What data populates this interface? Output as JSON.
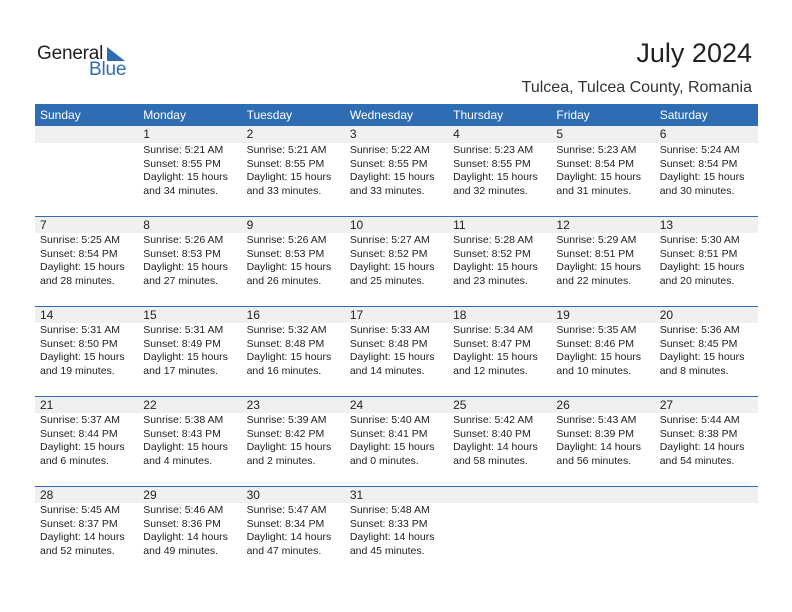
{
  "logo": {
    "word1": "General",
    "word2": "Blue"
  },
  "header": {
    "title": "July 2024",
    "location": "Tulcea, Tulcea County, Romania"
  },
  "colors": {
    "accent": "#2E6DB4",
    "band": "#F0F0F0"
  },
  "weekdays": [
    "Sunday",
    "Monday",
    "Tuesday",
    "Wednesday",
    "Thursday",
    "Friday",
    "Saturday"
  ],
  "weeks": [
    [
      null,
      {
        "day": "1",
        "sunrise": "Sunrise: 5:21 AM",
        "sunset": "Sunset: 8:55 PM",
        "daylight1": "Daylight: 15 hours",
        "daylight2": "and 34 minutes."
      },
      {
        "day": "2",
        "sunrise": "Sunrise: 5:21 AM",
        "sunset": "Sunset: 8:55 PM",
        "daylight1": "Daylight: 15 hours",
        "daylight2": "and 33 minutes."
      },
      {
        "day": "3",
        "sunrise": "Sunrise: 5:22 AM",
        "sunset": "Sunset: 8:55 PM",
        "daylight1": "Daylight: 15 hours",
        "daylight2": "and 33 minutes."
      },
      {
        "day": "4",
        "sunrise": "Sunrise: 5:23 AM",
        "sunset": "Sunset: 8:55 PM",
        "daylight1": "Daylight: 15 hours",
        "daylight2": "and 32 minutes."
      },
      {
        "day": "5",
        "sunrise": "Sunrise: 5:23 AM",
        "sunset": "Sunset: 8:54 PM",
        "daylight1": "Daylight: 15 hours",
        "daylight2": "and 31 minutes."
      },
      {
        "day": "6",
        "sunrise": "Sunrise: 5:24 AM",
        "sunset": "Sunset: 8:54 PM",
        "daylight1": "Daylight: 15 hours",
        "daylight2": "and 30 minutes."
      }
    ],
    [
      {
        "day": "7",
        "sunrise": "Sunrise: 5:25 AM",
        "sunset": "Sunset: 8:54 PM",
        "daylight1": "Daylight: 15 hours",
        "daylight2": "and 28 minutes."
      },
      {
        "day": "8",
        "sunrise": "Sunrise: 5:26 AM",
        "sunset": "Sunset: 8:53 PM",
        "daylight1": "Daylight: 15 hours",
        "daylight2": "and 27 minutes."
      },
      {
        "day": "9",
        "sunrise": "Sunrise: 5:26 AM",
        "sunset": "Sunset: 8:53 PM",
        "daylight1": "Daylight: 15 hours",
        "daylight2": "and 26 minutes."
      },
      {
        "day": "10",
        "sunrise": "Sunrise: 5:27 AM",
        "sunset": "Sunset: 8:52 PM",
        "daylight1": "Daylight: 15 hours",
        "daylight2": "and 25 minutes."
      },
      {
        "day": "11",
        "sunrise": "Sunrise: 5:28 AM",
        "sunset": "Sunset: 8:52 PM",
        "daylight1": "Daylight: 15 hours",
        "daylight2": "and 23 minutes."
      },
      {
        "day": "12",
        "sunrise": "Sunrise: 5:29 AM",
        "sunset": "Sunset: 8:51 PM",
        "daylight1": "Daylight: 15 hours",
        "daylight2": "and 22 minutes."
      },
      {
        "day": "13",
        "sunrise": "Sunrise: 5:30 AM",
        "sunset": "Sunset: 8:51 PM",
        "daylight1": "Daylight: 15 hours",
        "daylight2": "and 20 minutes."
      }
    ],
    [
      {
        "day": "14",
        "sunrise": "Sunrise: 5:31 AM",
        "sunset": "Sunset: 8:50 PM",
        "daylight1": "Daylight: 15 hours",
        "daylight2": "and 19 minutes."
      },
      {
        "day": "15",
        "sunrise": "Sunrise: 5:31 AM",
        "sunset": "Sunset: 8:49 PM",
        "daylight1": "Daylight: 15 hours",
        "daylight2": "and 17 minutes."
      },
      {
        "day": "16",
        "sunrise": "Sunrise: 5:32 AM",
        "sunset": "Sunset: 8:48 PM",
        "daylight1": "Daylight: 15 hours",
        "daylight2": "and 16 minutes."
      },
      {
        "day": "17",
        "sunrise": "Sunrise: 5:33 AM",
        "sunset": "Sunset: 8:48 PM",
        "daylight1": "Daylight: 15 hours",
        "daylight2": "and 14 minutes."
      },
      {
        "day": "18",
        "sunrise": "Sunrise: 5:34 AM",
        "sunset": "Sunset: 8:47 PM",
        "daylight1": "Daylight: 15 hours",
        "daylight2": "and 12 minutes."
      },
      {
        "day": "19",
        "sunrise": "Sunrise: 5:35 AM",
        "sunset": "Sunset: 8:46 PM",
        "daylight1": "Daylight: 15 hours",
        "daylight2": "and 10 minutes."
      },
      {
        "day": "20",
        "sunrise": "Sunrise: 5:36 AM",
        "sunset": "Sunset: 8:45 PM",
        "daylight1": "Daylight: 15 hours",
        "daylight2": "and 8 minutes."
      }
    ],
    [
      {
        "day": "21",
        "sunrise": "Sunrise: 5:37 AM",
        "sunset": "Sunset: 8:44 PM",
        "daylight1": "Daylight: 15 hours",
        "daylight2": "and 6 minutes."
      },
      {
        "day": "22",
        "sunrise": "Sunrise: 5:38 AM",
        "sunset": "Sunset: 8:43 PM",
        "daylight1": "Daylight: 15 hours",
        "daylight2": "and 4 minutes."
      },
      {
        "day": "23",
        "sunrise": "Sunrise: 5:39 AM",
        "sunset": "Sunset: 8:42 PM",
        "daylight1": "Daylight: 15 hours",
        "daylight2": "and 2 minutes."
      },
      {
        "day": "24",
        "sunrise": "Sunrise: 5:40 AM",
        "sunset": "Sunset: 8:41 PM",
        "daylight1": "Daylight: 15 hours",
        "daylight2": "and 0 minutes."
      },
      {
        "day": "25",
        "sunrise": "Sunrise: 5:42 AM",
        "sunset": "Sunset: 8:40 PM",
        "daylight1": "Daylight: 14 hours",
        "daylight2": "and 58 minutes."
      },
      {
        "day": "26",
        "sunrise": "Sunrise: 5:43 AM",
        "sunset": "Sunset: 8:39 PM",
        "daylight1": "Daylight: 14 hours",
        "daylight2": "and 56 minutes."
      },
      {
        "day": "27",
        "sunrise": "Sunrise: 5:44 AM",
        "sunset": "Sunset: 8:38 PM",
        "daylight1": "Daylight: 14 hours",
        "daylight2": "and 54 minutes."
      }
    ],
    [
      {
        "day": "28",
        "sunrise": "Sunrise: 5:45 AM",
        "sunset": "Sunset: 8:37 PM",
        "daylight1": "Daylight: 14 hours",
        "daylight2": "and 52 minutes."
      },
      {
        "day": "29",
        "sunrise": "Sunrise: 5:46 AM",
        "sunset": "Sunset: 8:36 PM",
        "daylight1": "Daylight: 14 hours",
        "daylight2": "and 49 minutes."
      },
      {
        "day": "30",
        "sunrise": "Sunrise: 5:47 AM",
        "sunset": "Sunset: 8:34 PM",
        "daylight1": "Daylight: 14 hours",
        "daylight2": "and 47 minutes."
      },
      {
        "day": "31",
        "sunrise": "Sunrise: 5:48 AM",
        "sunset": "Sunset: 8:33 PM",
        "daylight1": "Daylight: 14 hours",
        "daylight2": "and 45 minutes."
      },
      null,
      null,
      null
    ]
  ]
}
